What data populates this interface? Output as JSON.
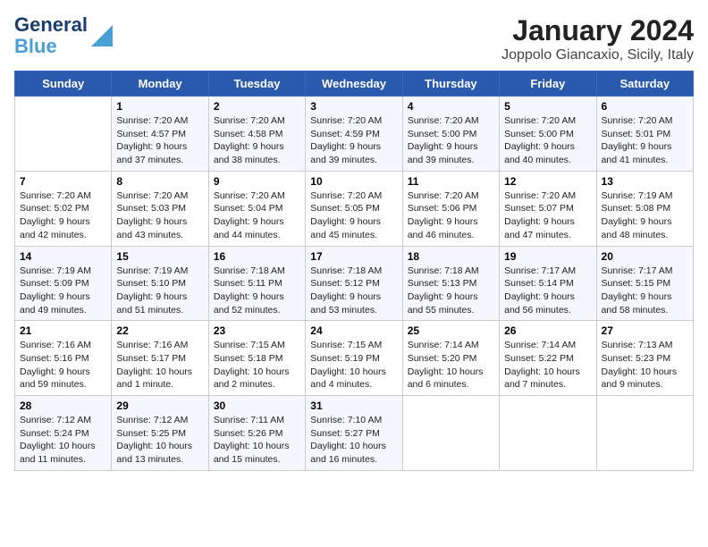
{
  "logo": {
    "line1": "General",
    "line2": "Blue"
  },
  "title": "January 2024",
  "subtitle": "Joppolo Giancaxio, Sicily, Italy",
  "days_of_week": [
    "Sunday",
    "Monday",
    "Tuesday",
    "Wednesday",
    "Thursday",
    "Friday",
    "Saturday"
  ],
  "weeks": [
    [
      {
        "day": "",
        "text": ""
      },
      {
        "day": "1",
        "text": "Sunrise: 7:20 AM\nSunset: 4:57 PM\nDaylight: 9 hours\nand 37 minutes."
      },
      {
        "day": "2",
        "text": "Sunrise: 7:20 AM\nSunset: 4:58 PM\nDaylight: 9 hours\nand 38 minutes."
      },
      {
        "day": "3",
        "text": "Sunrise: 7:20 AM\nSunset: 4:59 PM\nDaylight: 9 hours\nand 39 minutes."
      },
      {
        "day": "4",
        "text": "Sunrise: 7:20 AM\nSunset: 5:00 PM\nDaylight: 9 hours\nand 39 minutes."
      },
      {
        "day": "5",
        "text": "Sunrise: 7:20 AM\nSunset: 5:00 PM\nDaylight: 9 hours\nand 40 minutes."
      },
      {
        "day": "6",
        "text": "Sunrise: 7:20 AM\nSunset: 5:01 PM\nDaylight: 9 hours\nand 41 minutes."
      }
    ],
    [
      {
        "day": "7",
        "text": "Sunrise: 7:20 AM\nSunset: 5:02 PM\nDaylight: 9 hours\nand 42 minutes."
      },
      {
        "day": "8",
        "text": "Sunrise: 7:20 AM\nSunset: 5:03 PM\nDaylight: 9 hours\nand 43 minutes."
      },
      {
        "day": "9",
        "text": "Sunrise: 7:20 AM\nSunset: 5:04 PM\nDaylight: 9 hours\nand 44 minutes."
      },
      {
        "day": "10",
        "text": "Sunrise: 7:20 AM\nSunset: 5:05 PM\nDaylight: 9 hours\nand 45 minutes."
      },
      {
        "day": "11",
        "text": "Sunrise: 7:20 AM\nSunset: 5:06 PM\nDaylight: 9 hours\nand 46 minutes."
      },
      {
        "day": "12",
        "text": "Sunrise: 7:20 AM\nSunset: 5:07 PM\nDaylight: 9 hours\nand 47 minutes."
      },
      {
        "day": "13",
        "text": "Sunrise: 7:19 AM\nSunset: 5:08 PM\nDaylight: 9 hours\nand 48 minutes."
      }
    ],
    [
      {
        "day": "14",
        "text": "Sunrise: 7:19 AM\nSunset: 5:09 PM\nDaylight: 9 hours\nand 49 minutes."
      },
      {
        "day": "15",
        "text": "Sunrise: 7:19 AM\nSunset: 5:10 PM\nDaylight: 9 hours\nand 51 minutes."
      },
      {
        "day": "16",
        "text": "Sunrise: 7:18 AM\nSunset: 5:11 PM\nDaylight: 9 hours\nand 52 minutes."
      },
      {
        "day": "17",
        "text": "Sunrise: 7:18 AM\nSunset: 5:12 PM\nDaylight: 9 hours\nand 53 minutes."
      },
      {
        "day": "18",
        "text": "Sunrise: 7:18 AM\nSunset: 5:13 PM\nDaylight: 9 hours\nand 55 minutes."
      },
      {
        "day": "19",
        "text": "Sunrise: 7:17 AM\nSunset: 5:14 PM\nDaylight: 9 hours\nand 56 minutes."
      },
      {
        "day": "20",
        "text": "Sunrise: 7:17 AM\nSunset: 5:15 PM\nDaylight: 9 hours\nand 58 minutes."
      }
    ],
    [
      {
        "day": "21",
        "text": "Sunrise: 7:16 AM\nSunset: 5:16 PM\nDaylight: 9 hours\nand 59 minutes."
      },
      {
        "day": "22",
        "text": "Sunrise: 7:16 AM\nSunset: 5:17 PM\nDaylight: 10 hours\nand 1 minute."
      },
      {
        "day": "23",
        "text": "Sunrise: 7:15 AM\nSunset: 5:18 PM\nDaylight: 10 hours\nand 2 minutes."
      },
      {
        "day": "24",
        "text": "Sunrise: 7:15 AM\nSunset: 5:19 PM\nDaylight: 10 hours\nand 4 minutes."
      },
      {
        "day": "25",
        "text": "Sunrise: 7:14 AM\nSunset: 5:20 PM\nDaylight: 10 hours\nand 6 minutes."
      },
      {
        "day": "26",
        "text": "Sunrise: 7:14 AM\nSunset: 5:22 PM\nDaylight: 10 hours\nand 7 minutes."
      },
      {
        "day": "27",
        "text": "Sunrise: 7:13 AM\nSunset: 5:23 PM\nDaylight: 10 hours\nand 9 minutes."
      }
    ],
    [
      {
        "day": "28",
        "text": "Sunrise: 7:12 AM\nSunset: 5:24 PM\nDaylight: 10 hours\nand 11 minutes."
      },
      {
        "day": "29",
        "text": "Sunrise: 7:12 AM\nSunset: 5:25 PM\nDaylight: 10 hours\nand 13 minutes."
      },
      {
        "day": "30",
        "text": "Sunrise: 7:11 AM\nSunset: 5:26 PM\nDaylight: 10 hours\nand 15 minutes."
      },
      {
        "day": "31",
        "text": "Sunrise: 7:10 AM\nSunset: 5:27 PM\nDaylight: 10 hours\nand 16 minutes."
      },
      {
        "day": "",
        "text": ""
      },
      {
        "day": "",
        "text": ""
      },
      {
        "day": "",
        "text": ""
      }
    ]
  ]
}
